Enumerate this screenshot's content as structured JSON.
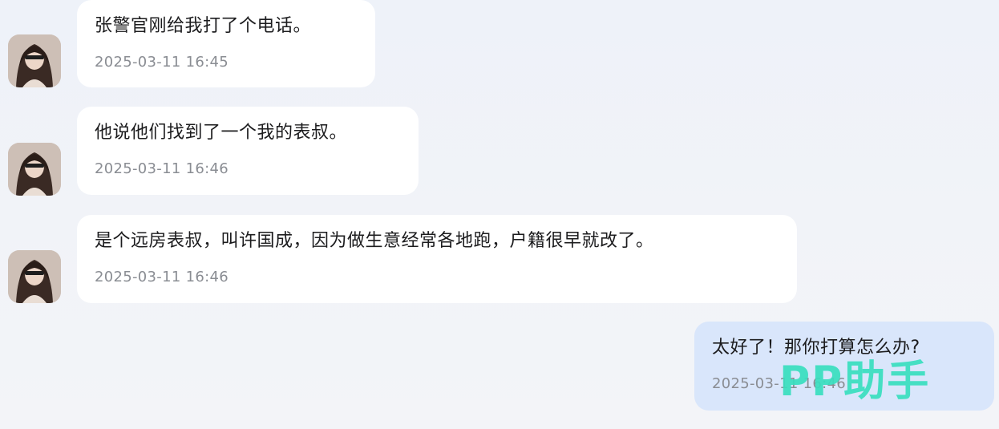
{
  "messages": [
    {
      "sender": "contact",
      "text": "张警官刚给我打了个电话。",
      "time": "2025-03-11 16:45"
    },
    {
      "sender": "contact",
      "text": "他说他们找到了一个我的表叔。",
      "time": "2025-03-11 16:46"
    },
    {
      "sender": "contact",
      "text": "是个远房表叔，叫许国成，因为做生意经常各地跑，户籍很早就改了。",
      "time": "2025-03-11 16:46"
    },
    {
      "sender": "me",
      "text": "太好了！那你打算怎么办?",
      "time": "2025-03-11 16:46"
    }
  ],
  "watermark": "PP助手",
  "colors": {
    "incoming_bubble": "#ffffff",
    "outgoing_bubble": "#d9e6fb",
    "watermark": "#38debe"
  },
  "icons": {
    "avatar": "contact-avatar-portrait"
  }
}
